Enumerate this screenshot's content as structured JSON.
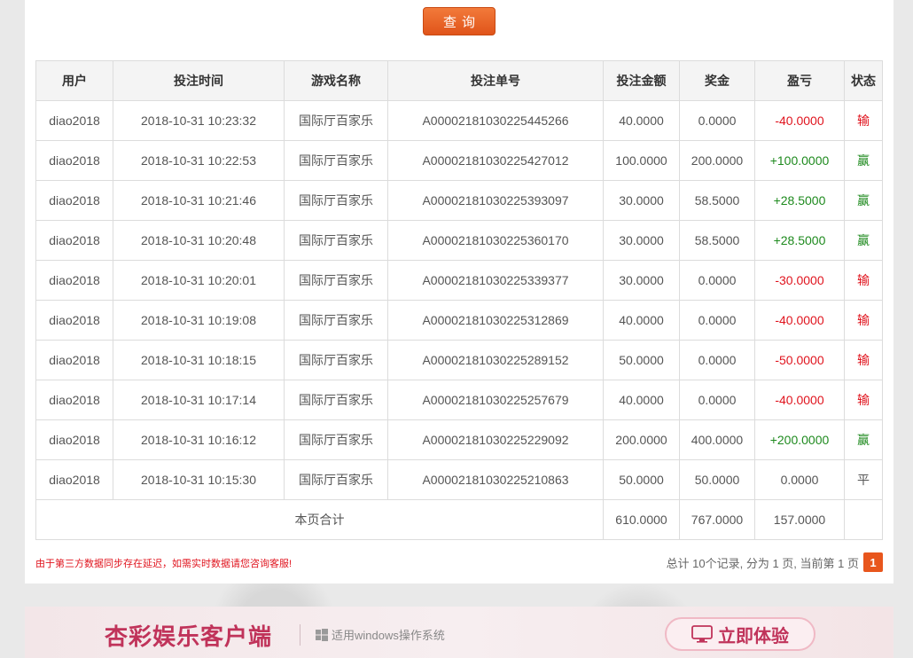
{
  "query_button": {
    "label": "查询"
  },
  "table": {
    "headers": [
      "用户",
      "投注时间",
      "游戏名称",
      "投注单号",
      "投注金额",
      "奖金",
      "盈亏",
      "状态"
    ],
    "rows": [
      {
        "user": "diao2018",
        "time": "2018-10-31 10:23:32",
        "game": "国际厅百家乐",
        "order": "A0000218103022544526​6",
        "amount": "40.0000",
        "bonus": "0.0000",
        "profit": "-40.0000",
        "status": "输",
        "result": "lose"
      },
      {
        "user": "diao2018",
        "time": "2018-10-31 10:22:53",
        "game": "国际厅百家乐",
        "order": "A00002181030225427012",
        "amount": "100.0000",
        "bonus": "200.0000",
        "profit": "+100.0000",
        "status": "赢",
        "result": "win"
      },
      {
        "user": "diao2018",
        "time": "2018-10-31 10:21:46",
        "game": "国际厅百家乐",
        "order": "A00002181030225393097",
        "amount": "30.0000",
        "bonus": "58.5000",
        "profit": "+28.5000",
        "status": "赢",
        "result": "win"
      },
      {
        "user": "diao2018",
        "time": "2018-10-31 10:20:48",
        "game": "国际厅百家乐",
        "order": "A00002181030225360170",
        "amount": "30.0000",
        "bonus": "58.5000",
        "profit": "+28.5000",
        "status": "赢",
        "result": "win"
      },
      {
        "user": "diao2018",
        "time": "2018-10-31 10:20:01",
        "game": "国际厅百家乐",
        "order": "A00002181030225339377",
        "amount": "30.0000",
        "bonus": "0.0000",
        "profit": "-30.0000",
        "status": "输",
        "result": "lose"
      },
      {
        "user": "diao2018",
        "time": "2018-10-31 10:19:08",
        "game": "国际厅百家乐",
        "order": "A00002181030225312869",
        "amount": "40.0000",
        "bonus": "0.0000",
        "profit": "-40.0000",
        "status": "输",
        "result": "lose"
      },
      {
        "user": "diao2018",
        "time": "2018-10-31 10:18:15",
        "game": "国际厅百家乐",
        "order": "A00002181030225289152",
        "amount": "50.0000",
        "bonus": "0.0000",
        "profit": "-50.0000",
        "status": "输",
        "result": "lose"
      },
      {
        "user": "diao2018",
        "time": "2018-10-31 10:17:14",
        "game": "国际厅百家乐",
        "order": "A00002181030225257679",
        "amount": "40.0000",
        "bonus": "0.0000",
        "profit": "-40.0000",
        "status": "输",
        "result": "lose"
      },
      {
        "user": "diao2018",
        "time": "2018-10-31 10:16:12",
        "game": "国际厅百家乐",
        "order": "A00002181030225229092",
        "amount": "200.0000",
        "bonus": "400.0000",
        "profit": "+200.0000",
        "status": "赢",
        "result": "win"
      },
      {
        "user": "diao2018",
        "time": "2018-10-31 10:15:30",
        "game": "国际厅百家乐",
        "order": "A00002181030225210863",
        "amount": "50.0000",
        "bonus": "50.0000",
        "profit": "0.0000",
        "status": "平",
        "result": "even"
      }
    ],
    "totals": {
      "label": "本页合计",
      "amount": "610.0000",
      "bonus": "767.0000",
      "profit": "157.0000"
    }
  },
  "notice": "由于第三方数据同步存在延迟，如需实时数据请您咨询客服!",
  "pager": {
    "summary": "总计 10个记录, 分为 1 页, 当前第 1 页",
    "current_page": "1"
  },
  "banner": {
    "title": "杏彩娱乐客户端",
    "os_text": "适用windows操作系统",
    "try_button": "立即体验"
  },
  "colors": {
    "accent": "#e8561d",
    "win": "#1e8a1e",
    "lose": "#e0141e",
    "banner_text": "#c0335a"
  },
  "icons": {
    "os": "windows-logo-icon",
    "try": "monitor-icon"
  }
}
